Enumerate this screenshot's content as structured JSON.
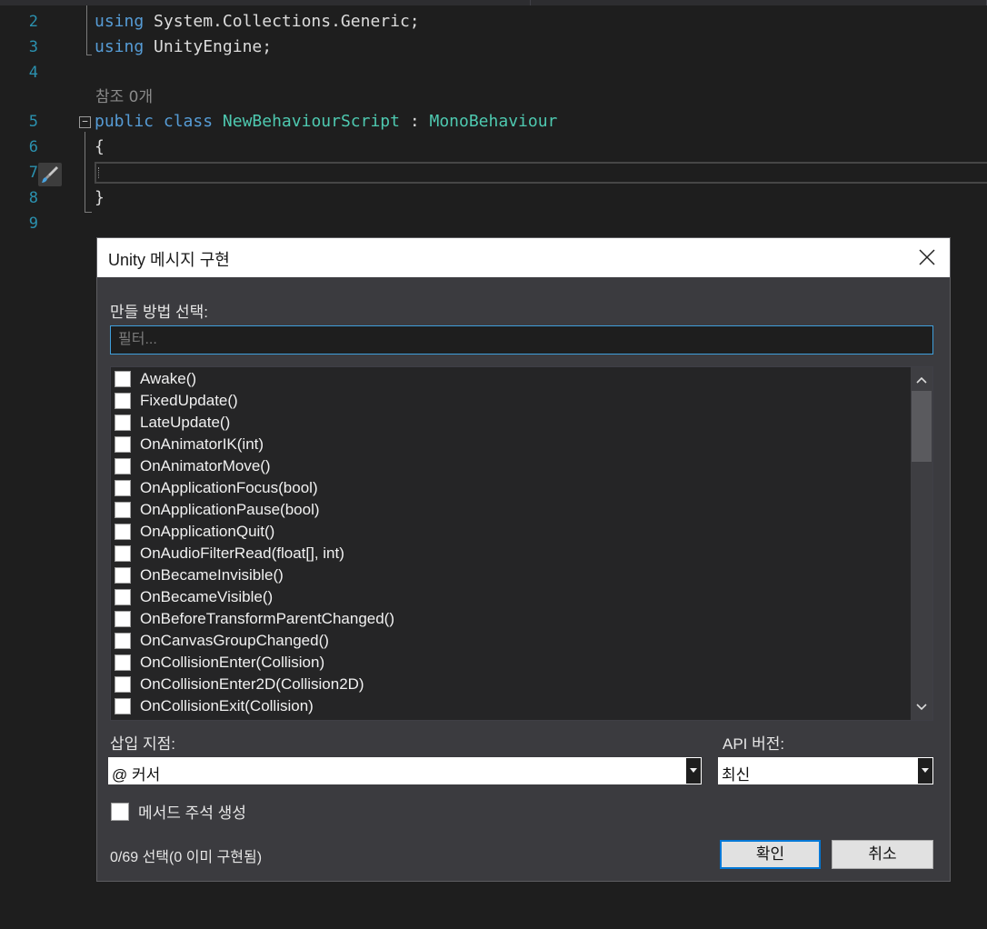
{
  "editor": {
    "lines": [
      {
        "num": "2",
        "using_kw": "using",
        "ns": "System.Collections.Generic;"
      },
      {
        "num": "3",
        "using_kw": "using",
        "ns": "UnityEngine;"
      },
      {
        "num": "4"
      },
      {
        "codelens": "참조 0개"
      },
      {
        "num": "5",
        "kw1": "public",
        "kw2": "class",
        "class_name": "NewBehaviourScript",
        "colon": " : ",
        "base": "MonoBehaviour"
      },
      {
        "num": "6",
        "text": "{"
      },
      {
        "num": "7"
      },
      {
        "num": "8",
        "text": "}"
      },
      {
        "num": "9"
      }
    ],
    "collapse_glyph": "−"
  },
  "dialog": {
    "title": "Unity 메시지 구현",
    "create_label": "만들 방법 선택:",
    "filter_placeholder": "필터...",
    "methods": [
      "Awake()",
      "FixedUpdate()",
      "LateUpdate()",
      "OnAnimatorIK(int)",
      "OnAnimatorMove()",
      "OnApplicationFocus(bool)",
      "OnApplicationPause(bool)",
      "OnApplicationQuit()",
      "OnAudioFilterRead(float[], int)",
      "OnBecameInvisible()",
      "OnBecameVisible()",
      "OnBeforeTransformParentChanged()",
      "OnCanvasGroupChanged()",
      "OnCollisionEnter(Collision)",
      "OnCollisionEnter2D(Collision2D)",
      "OnCollisionExit(Collision)"
    ],
    "insert_label": "삽입 지점:",
    "insert_value": "@ 커서",
    "api_label": "API 버전:",
    "api_value": "최신",
    "comments_label": "메서드 주석 생성",
    "status": "0/69 선택(0 이미 구현됨)",
    "ok_label": "확인",
    "cancel_label": "취소"
  },
  "colors": {
    "keyword": "#569cd6",
    "type": "#4ec9b0",
    "line_number": "#2b91af",
    "focus_accent": "#0078d7"
  }
}
